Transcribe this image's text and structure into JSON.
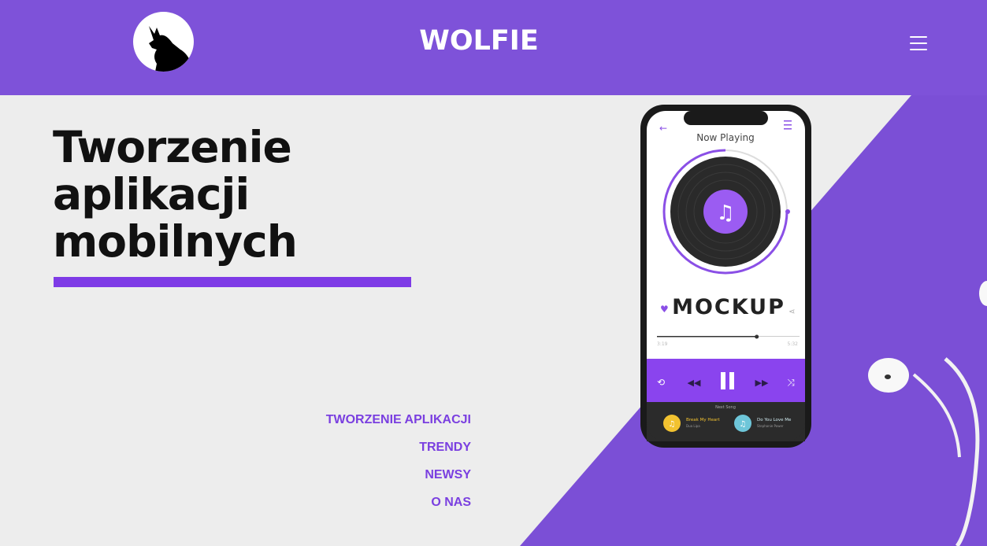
{
  "header": {
    "brand": "WOLFIE",
    "logo_icon": "wolf-icon",
    "menu_icon": "hamburger-icon"
  },
  "hero": {
    "title_lines": [
      "Tworzenie",
      "aplikacji",
      "mobilnych"
    ]
  },
  "nav": {
    "items": [
      {
        "label": "TWORZENIE APLIKACJI"
      },
      {
        "label": "TRENDY"
      },
      {
        "label": "NEWSY"
      },
      {
        "label": "O NAS"
      }
    ]
  },
  "phone": {
    "screen_title": "Now Playing",
    "mockup_text": "MOCKUP",
    "time_elapsed": "3:19",
    "time_total": "5:32",
    "next_song_label": "Next Song",
    "next_songs": [
      {
        "title": "Break My Heart",
        "artist": "Dua Lipa"
      },
      {
        "title": "Do You Love Me",
        "artist": "Stephanie Power"
      }
    ],
    "progress": 0.7
  },
  "colors": {
    "brand_purple": "#7e52d9",
    "accent_purple": "#7e3be6",
    "link_purple": "#7a3fe0",
    "background": "#ececec"
  }
}
